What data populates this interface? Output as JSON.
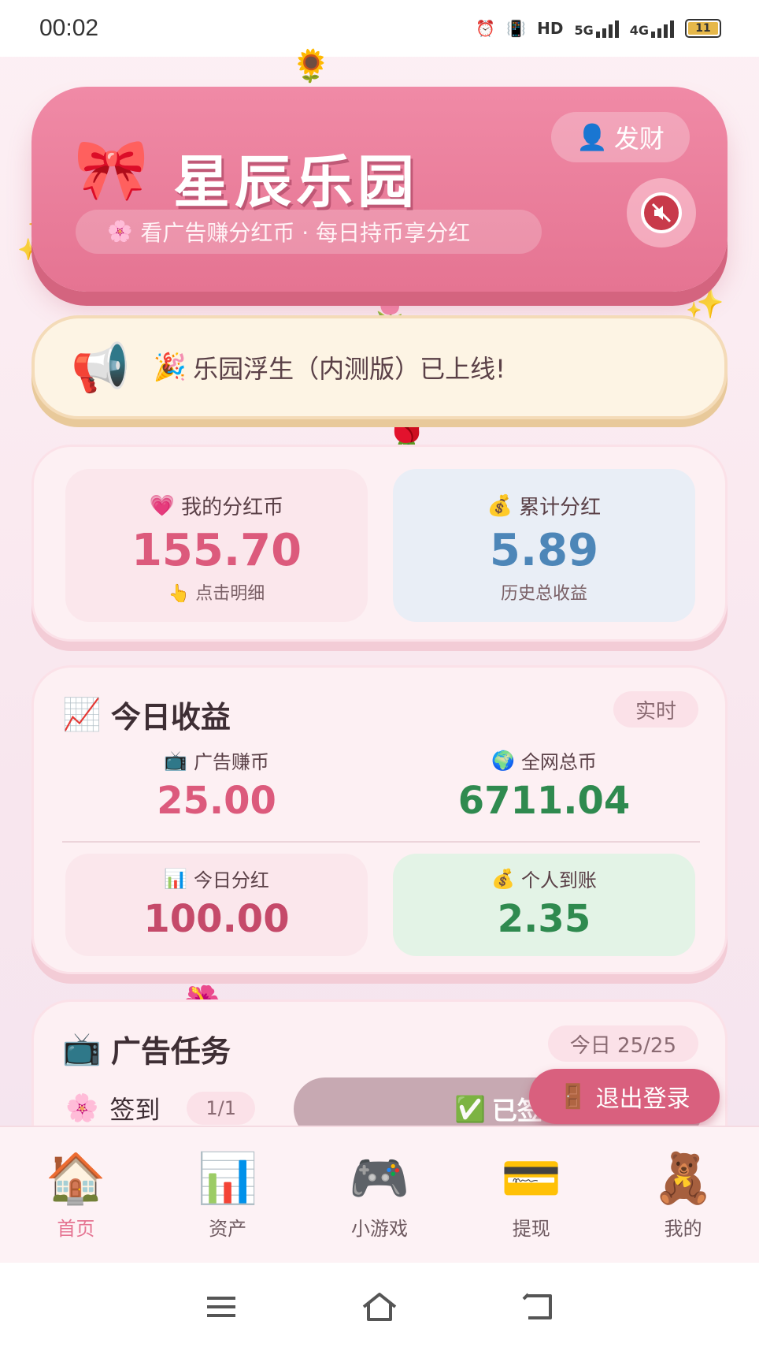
{
  "status_bar": {
    "time": "00:02",
    "icons": [
      "alarm-icon",
      "vibrate-icon",
      "hd-icon",
      "5g-signal-icon",
      "4g-signal-icon",
      "battery-icon"
    ],
    "hd_label": "HD",
    "net1": "5G",
    "net2": "4G",
    "battery": "11"
  },
  "header": {
    "title": "星辰乐园",
    "slogan": "看广告赚分红币 · 每日持币享分红",
    "user_name": "发财",
    "bow_icon": "🎀",
    "flower_icon": "🌸",
    "user_icon": "👤"
  },
  "notice": {
    "megaphone_icon": "📢",
    "party_icon": "🎉",
    "text": "乐园浮生（内测版）已上线!"
  },
  "wallet": {
    "mine": {
      "icon": "💗",
      "label": "我的分红币",
      "value": "155.70",
      "hint_icon": "👆",
      "hint": "点击明细"
    },
    "total": {
      "icon": "💰",
      "label": "累计分红",
      "value": "5.89",
      "sub": "历史总收益"
    }
  },
  "today": {
    "icon": "📈",
    "title": "今日收益",
    "badge": "实时",
    "ad_coins": {
      "icon": "📺",
      "label": "广告赚币",
      "value": "25.00"
    },
    "network_coins": {
      "icon": "🌍",
      "label": "全网总币",
      "value": "6711.04"
    },
    "dividend": {
      "icon": "📊",
      "label": "今日分红",
      "value": "100.00"
    },
    "personal": {
      "icon": "💰",
      "label": "个人到账",
      "value": "2.35"
    }
  },
  "tasks": {
    "icon": "📺",
    "title": "广告任务",
    "badge": "今日 25/25",
    "row": {
      "icon": "🌸",
      "name": "签到",
      "count": "1/1",
      "button_icon": "✅",
      "button": "已签"
    }
  },
  "logout": {
    "icon": "🚪",
    "label": "退出登录"
  },
  "nav": [
    {
      "icon": "🏠",
      "label": "首页"
    },
    {
      "icon": "📊",
      "label": "资产"
    },
    {
      "icon": "🎮",
      "label": "小游戏"
    },
    {
      "icon": "💳",
      "label": "提现"
    },
    {
      "icon": "🧸",
      "label": "我的"
    }
  ],
  "colors": {
    "header_pink": "#e57492",
    "accent_red": "#dc5a7c",
    "accent_blue": "#4d86b8",
    "accent_green": "#2f8a4f",
    "logout": "#d9607e"
  }
}
